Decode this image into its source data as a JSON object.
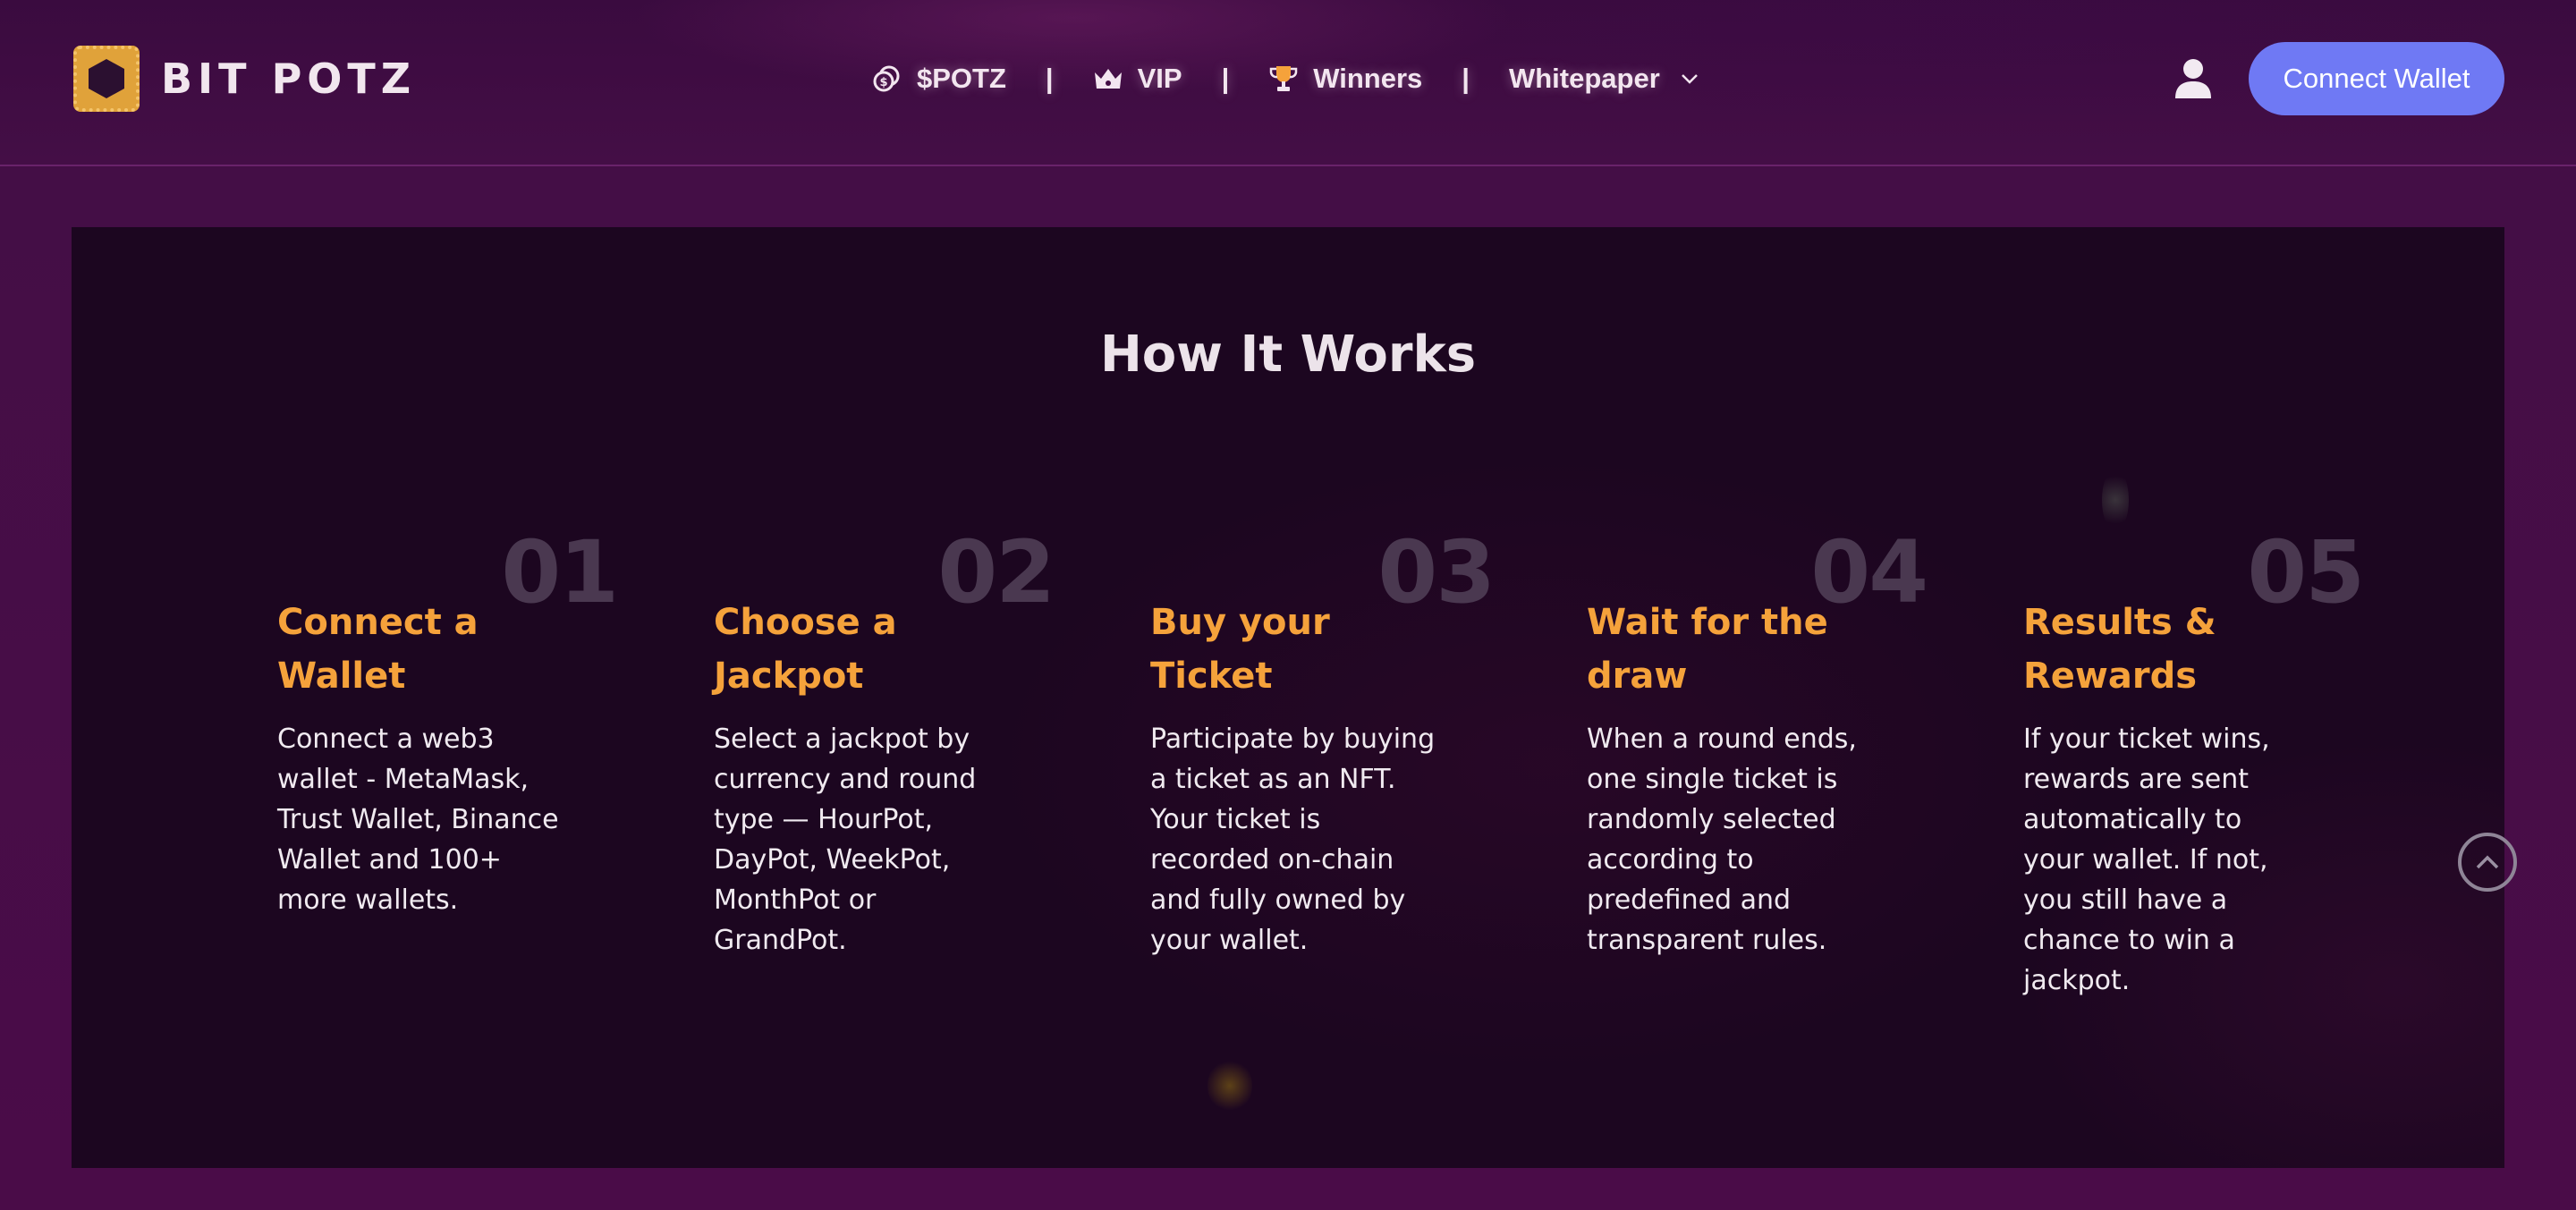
{
  "header": {
    "logo_text": "BIT POTZ",
    "nav": [
      {
        "label": "$POTZ",
        "icon": "coin-icon"
      },
      {
        "label": "VIP",
        "icon": "crown-icon"
      },
      {
        "label": "Winners",
        "icon": "trophy-icon"
      },
      {
        "label": "Whitepaper",
        "icon": "chevron-down-icon"
      }
    ],
    "separator": "|",
    "connect_wallet": "Connect Wallet",
    "user_icon": "user-icon"
  },
  "main": {
    "title": "How It Works",
    "steps": [
      {
        "number": "01",
        "title": "Connect a Wallet",
        "description": "Connect a web3 wallet - MetaMask, Trust Wallet, Binance Wallet and 100+ more wallets."
      },
      {
        "number": "02",
        "title": "Choose a Jackpot",
        "description": "Select a jackpot by currency and round type — HourPot, DayPot, WeekPot, MonthPot or GrandPot."
      },
      {
        "number": "03",
        "title": "Buy your Ticket",
        "description": "Participate by buying a ticket as an NFT. Your ticket is recorded on-chain and fully owned by your wallet."
      },
      {
        "number": "04",
        "title": "Wait for the draw",
        "description": "When a round ends, one single ticket is randomly selected according to predefined and transparent rules."
      },
      {
        "number": "05",
        "title": "Results & Rewards",
        "description": "If your ticket wins, rewards are sent automatically to your wallet. If not, you still have a chance to win a jackpot."
      }
    ],
    "scroll_top_icon": "chevron-up-icon"
  },
  "colors": {
    "accent_orange": "#f5a23b",
    "button_blue": "#6f79f4",
    "panel_bg": "#1c0620",
    "page_bg": "#430d44"
  }
}
